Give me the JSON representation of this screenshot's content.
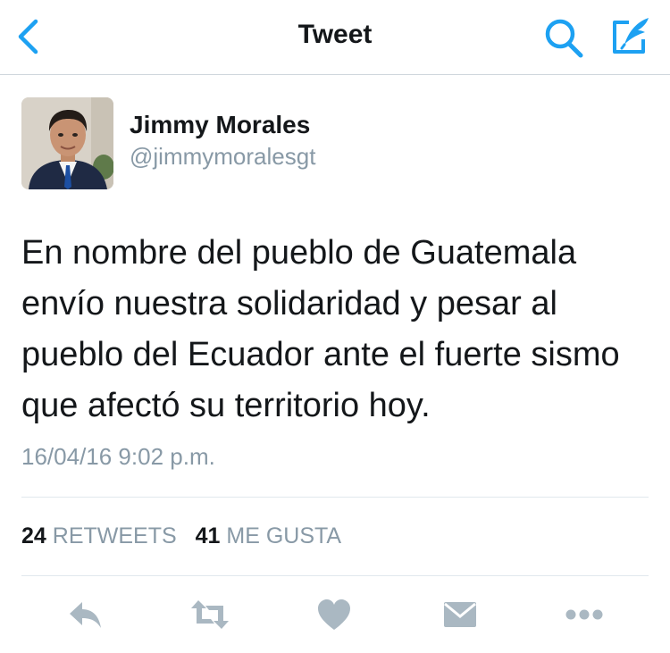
{
  "header": {
    "title": "Tweet",
    "back_icon": "chevron-left-icon",
    "search_icon": "search-icon",
    "compose_icon": "compose-icon",
    "accent_color": "#1da1f2"
  },
  "tweet": {
    "author_name": "Jimmy Morales",
    "author_handle": "@jimmymoralesgt",
    "text": "En nombre del pueblo de Guatemala envío nuestra solidaridad y pesar al pueblo del Ecuador ante el fuerte sismo que afectó su territorio hoy.",
    "timestamp": "16/04/16 9:02 p.m."
  },
  "stats": {
    "retweets_count": "24",
    "retweets_label": "RETWEETS",
    "likes_count": "41",
    "likes_label": "ME GUSTA"
  },
  "actions": {
    "icons": [
      "reply-icon",
      "retweet-icon",
      "heart-icon",
      "direct-message-icon",
      "more-icon"
    ],
    "icon_color": "#aab8c2"
  }
}
